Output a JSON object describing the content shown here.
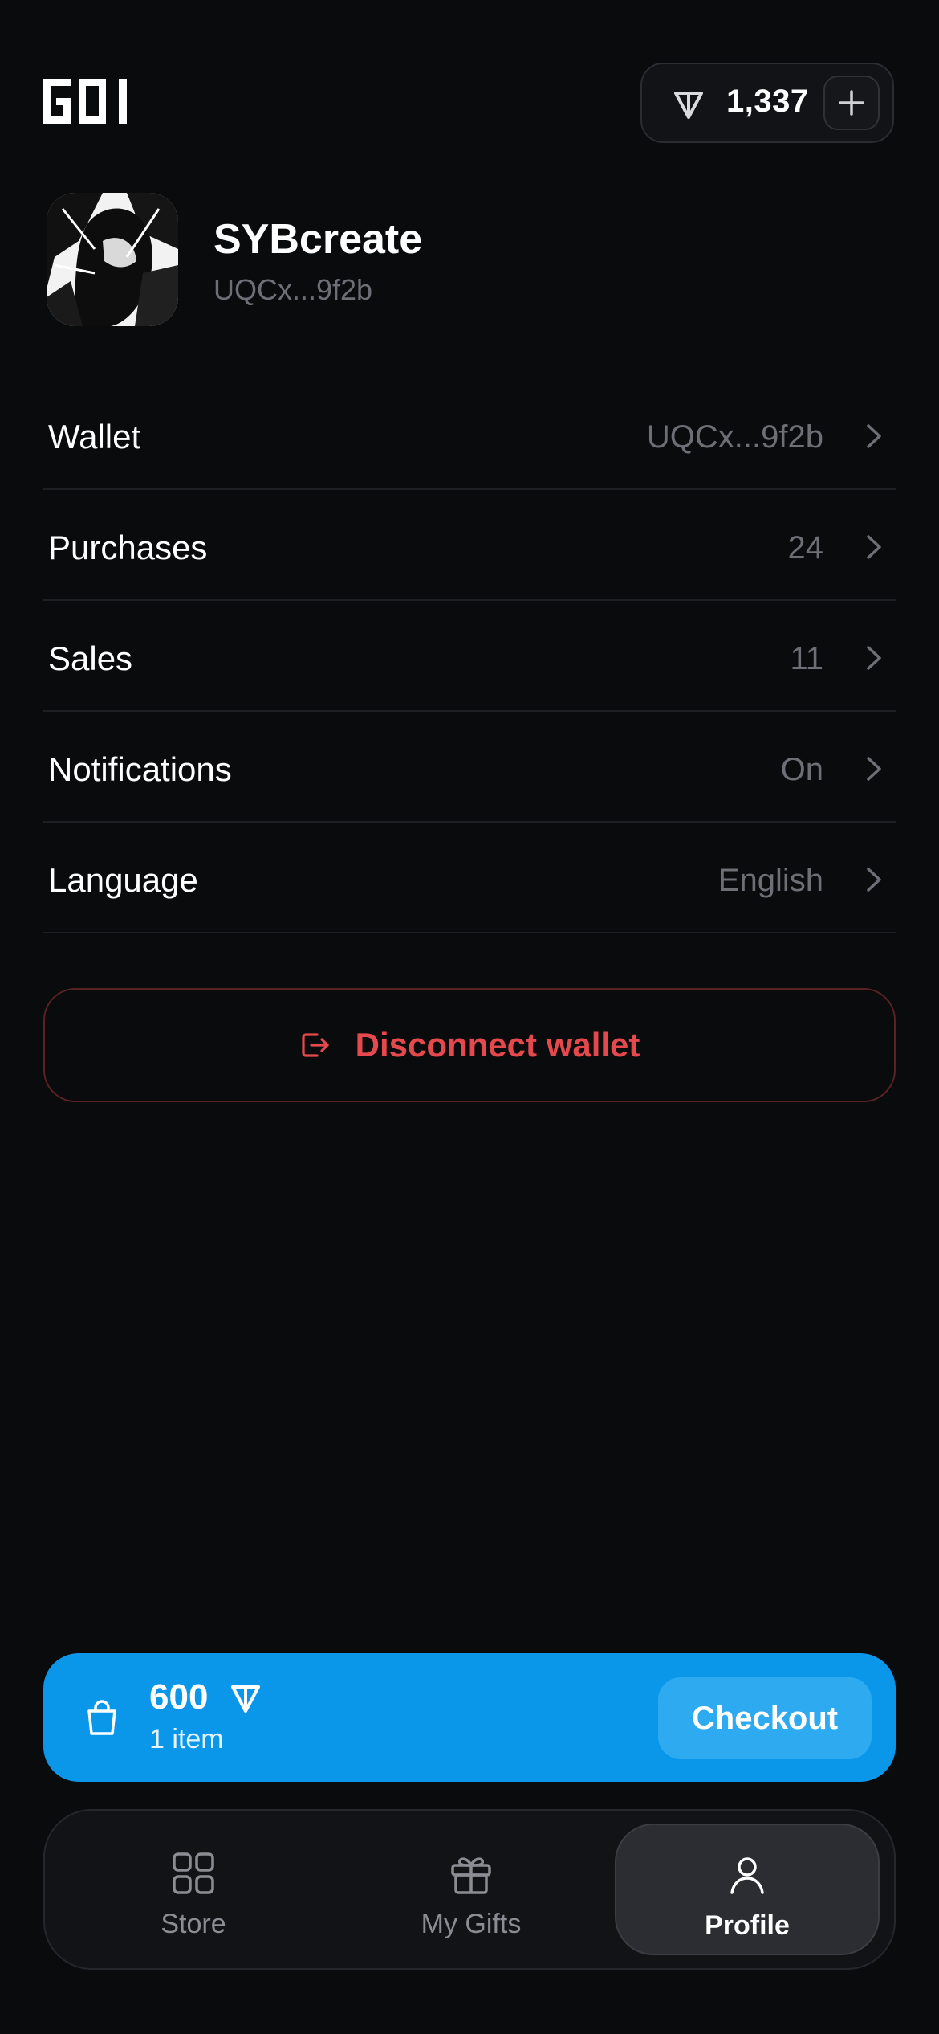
{
  "header": {
    "logo_text": "GOI",
    "balance": "1,337"
  },
  "profile": {
    "username": "SYBcreate",
    "address": "UQCx...9f2b"
  },
  "settings": [
    {
      "label": "Wallet",
      "value": "UQCx...9f2b"
    },
    {
      "label": "Purchases",
      "value": "24"
    },
    {
      "label": "Sales",
      "value": "11"
    },
    {
      "label": "Notifications",
      "value": "On"
    },
    {
      "label": "Language",
      "value": "English"
    }
  ],
  "disconnect_label": "Disconnect wallet",
  "cart": {
    "price": "600",
    "items": "1 item",
    "checkout_label": "Checkout"
  },
  "tabs": [
    {
      "label": "Store",
      "icon": "grid-icon",
      "active": false
    },
    {
      "label": "My Gifts",
      "icon": "gift-icon",
      "active": false
    },
    {
      "label": "Profile",
      "icon": "user-icon",
      "active": true
    }
  ],
  "colors": {
    "background": "#0a0b0d",
    "accent": "#0a97ea",
    "danger": "#e5484d"
  }
}
